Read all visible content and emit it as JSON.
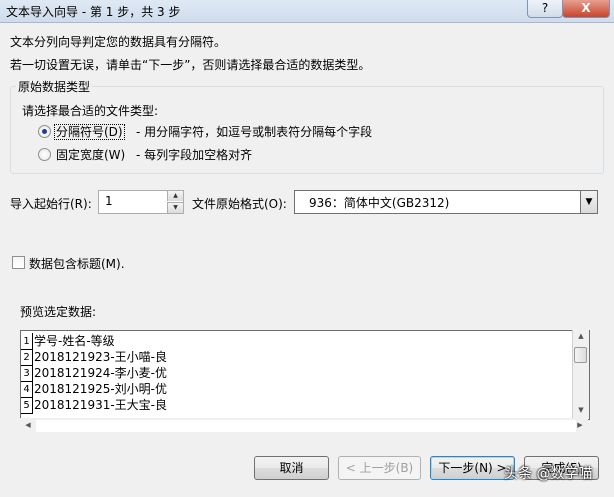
{
  "window": {
    "title": "文本导入向导 - 第 1 步，共 3 步",
    "help_label": "?",
    "close_label": "X"
  },
  "intro": {
    "line1": "文本分列向导判定您的数据具有分隔符。",
    "line2": "若一切设置无误，请单击“下一步”，否则请选择最合适的数据类型。"
  },
  "group": {
    "legend": "原始数据类型",
    "prompt": "请选择最合适的文件类型:",
    "options": [
      {
        "label": "分隔符号(D)",
        "desc": "- 用分隔字符，如逗号或制表符分隔每个字段",
        "selected": true
      },
      {
        "label": "固定宽度(W)",
        "desc": "- 每列字段加空格对齐",
        "selected": false
      }
    ]
  },
  "start_row": {
    "label": "导入起始行(R):",
    "value": "1"
  },
  "file_origin": {
    "label": "文件原始格式(O):",
    "value": "936：简体中文(GB2312)"
  },
  "header_checkbox": {
    "label": "数据包含标题(M).",
    "checked": false
  },
  "preview": {
    "label": "预览选定数据:",
    "rows": [
      {
        "num": "1",
        "text": "学号-姓名-等级"
      },
      {
        "num": "2",
        "text": "2018121923-王小喵-良"
      },
      {
        "num": "3",
        "text": "2018121924-李小麦-优"
      },
      {
        "num": "4",
        "text": "2018121925-刘小明-优"
      },
      {
        "num": "5",
        "text": "2018121931-王大宝-良"
      }
    ]
  },
  "buttons": {
    "cancel": "取消",
    "back": "< 上一步(B)",
    "next": "下一步(N) >",
    "finish": "完成(F)"
  },
  "watermark": "头条 @数学喵"
}
